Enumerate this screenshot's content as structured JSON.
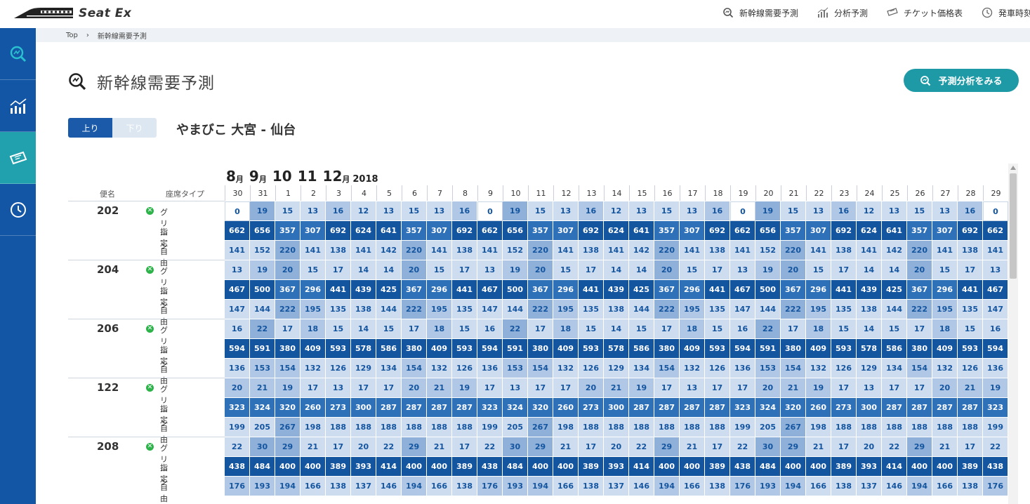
{
  "app": {
    "name": "Seat Ex"
  },
  "nav": {
    "items": [
      {
        "label": "新幹線需要予測",
        "icon": "forecast-search-icon"
      },
      {
        "label": "分析予測",
        "icon": "bar-chart-icon"
      },
      {
        "label": "チケット価格表",
        "icon": "ticket-icon"
      },
      {
        "label": "発車時刻",
        "icon": "clock-icon"
      }
    ]
  },
  "sidebar": {
    "items": [
      {
        "name": "forecast",
        "icon": "forecast-search-icon"
      },
      {
        "name": "analysis",
        "icon": "line-chart-icon"
      },
      {
        "name": "ticket",
        "icon": "ticket-icon",
        "active": true
      },
      {
        "name": "schedule",
        "icon": "clock-icon"
      }
    ]
  },
  "breadcrumb": {
    "home": "Top",
    "separator": "›",
    "current": "新幹線需要予測"
  },
  "page": {
    "title": "新幹線需要予測",
    "cta_label": "予測分析をみる"
  },
  "direction": {
    "up": "上り",
    "down": "下り",
    "selected": "up"
  },
  "route": {
    "label": "やまびこ 大宮 - 仙台"
  },
  "month_header": [
    {
      "num": "8",
      "unit": "月"
    },
    {
      "num": "9",
      "unit": "月"
    },
    {
      "num": "10",
      "unit": ""
    },
    {
      "num": "11",
      "unit": ""
    },
    {
      "num": "12",
      "unit": "月"
    }
  ],
  "year": "2018",
  "table": {
    "col_train": "便名",
    "col_seat": "座席タイプ",
    "seat_types": [
      "グリーン",
      "指定",
      "自由"
    ],
    "dates": [
      "30",
      "31",
      "1",
      "2",
      "3",
      "4",
      "5",
      "6",
      "7",
      "8",
      "9",
      "10",
      "11",
      "12",
      "13",
      "14",
      "15",
      "16",
      "17",
      "18",
      "19",
      "20",
      "21",
      "22",
      "23",
      "24",
      "25",
      "26",
      "27",
      "28",
      "29"
    ],
    "rows": [
      {
        "train": "202",
        "green": [
          0,
          19,
          15,
          13,
          16,
          12,
          13,
          15,
          13,
          16,
          0,
          19,
          15,
          13,
          16,
          12,
          13,
          15,
          13,
          16,
          0,
          19,
          15,
          13,
          16,
          12,
          13,
          15,
          13,
          16,
          0
        ],
        "reserved": [
          662,
          656,
          357,
          307,
          692,
          624,
          641,
          357,
          307,
          692,
          662,
          656,
          357,
          307,
          692,
          624,
          641,
          357,
          307,
          692,
          662,
          656,
          357,
          307,
          692,
          624,
          641,
          357,
          307,
          692,
          662
        ],
        "free": [
          141,
          152,
          220,
          141,
          138,
          141,
          142,
          220,
          141,
          138,
          141,
          152,
          220,
          141,
          138,
          141,
          142,
          220,
          141,
          138,
          141,
          152,
          220,
          141,
          138,
          141,
          142,
          220,
          141,
          138,
          141
        ]
      },
      {
        "train": "204",
        "green": [
          13,
          19,
          20,
          15,
          17,
          14,
          14,
          20,
          15,
          17,
          13,
          19,
          20,
          15,
          17,
          14,
          14,
          20,
          15,
          17,
          13,
          19,
          20,
          15,
          17,
          14,
          14,
          20,
          15,
          17,
          13
        ],
        "reserved": [
          467,
          500,
          367,
          296,
          441,
          439,
          425,
          367,
          296,
          441,
          467,
          500,
          367,
          296,
          441,
          439,
          425,
          367,
          296,
          441,
          467,
          500,
          367,
          296,
          441,
          439,
          425,
          367,
          296,
          441,
          467
        ],
        "free": [
          147,
          144,
          222,
          195,
          135,
          138,
          144,
          222,
          195,
          135,
          147,
          144,
          222,
          195,
          135,
          138,
          144,
          222,
          195,
          135,
          147,
          144,
          222,
          195,
          135,
          138,
          144,
          222,
          195,
          135,
          147
        ]
      },
      {
        "train": "206",
        "green": [
          16,
          22,
          17,
          18,
          15,
          14,
          15,
          17,
          18,
          15,
          16,
          22,
          17,
          18,
          15,
          14,
          15,
          17,
          18,
          15,
          16,
          22,
          17,
          18,
          15,
          14,
          15,
          17,
          18,
          15,
          16
        ],
        "reserved": [
          594,
          591,
          380,
          409,
          593,
          578,
          586,
          380,
          409,
          593,
          594,
          591,
          380,
          409,
          593,
          578,
          586,
          380,
          409,
          593,
          594,
          591,
          380,
          409,
          593,
          578,
          586,
          380,
          409,
          593,
          594
        ],
        "free": [
          136,
          153,
          154,
          132,
          126,
          129,
          134,
          154,
          132,
          126,
          136,
          153,
          154,
          132,
          126,
          129,
          134,
          154,
          132,
          126,
          136,
          153,
          154,
          132,
          126,
          129,
          134,
          154,
          132,
          126,
          136
        ]
      },
      {
        "train": "122",
        "green": [
          20,
          21,
          19,
          17,
          13,
          17,
          17,
          20,
          21,
          19,
          17,
          13,
          17,
          17,
          20,
          21,
          19,
          17,
          13,
          17,
          17,
          20,
          21,
          19,
          17,
          13,
          17,
          17,
          20,
          21,
          19
        ],
        "reserved": [
          323,
          324,
          320,
          260,
          273,
          300,
          287,
          287,
          287,
          287,
          323,
          324,
          320,
          260,
          273,
          300,
          287,
          287,
          287,
          287,
          323,
          324,
          320,
          260,
          273,
          300,
          287,
          287,
          287,
          287,
          323
        ],
        "free": [
          199,
          205,
          267,
          198,
          188,
          188,
          188,
          188,
          188,
          188,
          199,
          205,
          267,
          198,
          188,
          188,
          188,
          188,
          188,
          188,
          199,
          205,
          267,
          198,
          188,
          188,
          188,
          188,
          188,
          188,
          199
        ]
      },
      {
        "train": "208",
        "green": [
          22,
          30,
          29,
          21,
          17,
          20,
          22,
          29,
          21,
          17,
          22,
          30,
          29,
          21,
          17,
          20,
          22,
          29,
          21,
          17,
          22,
          30,
          29,
          21,
          17,
          20,
          22,
          29,
          21,
          17,
          22
        ],
        "reserved": [
          438,
          484,
          400,
          400,
          389,
          393,
          414,
          400,
          400,
          389,
          438,
          484,
          400,
          400,
          389,
          393,
          414,
          400,
          400,
          389,
          438,
          484,
          400,
          400,
          389,
          393,
          414,
          400,
          400,
          389,
          438
        ],
        "free": [
          176,
          193,
          194,
          166,
          138,
          137,
          146,
          194,
          166,
          138,
          176,
          193,
          194,
          166,
          138,
          137,
          146,
          194,
          166,
          138,
          176,
          193,
          194,
          166,
          138,
          137,
          146,
          194,
          166,
          138,
          176
        ]
      }
    ]
  },
  "colors": {
    "brand": "#1456a6",
    "accent": "#1e9aa6",
    "reserved_dark": "#1455a0",
    "reserved_light": "#2f71b8",
    "shade_light": "#cddcef",
    "shade_mid": "#b0c8e5",
    "shade_strong": "#8fb0d9"
  }
}
